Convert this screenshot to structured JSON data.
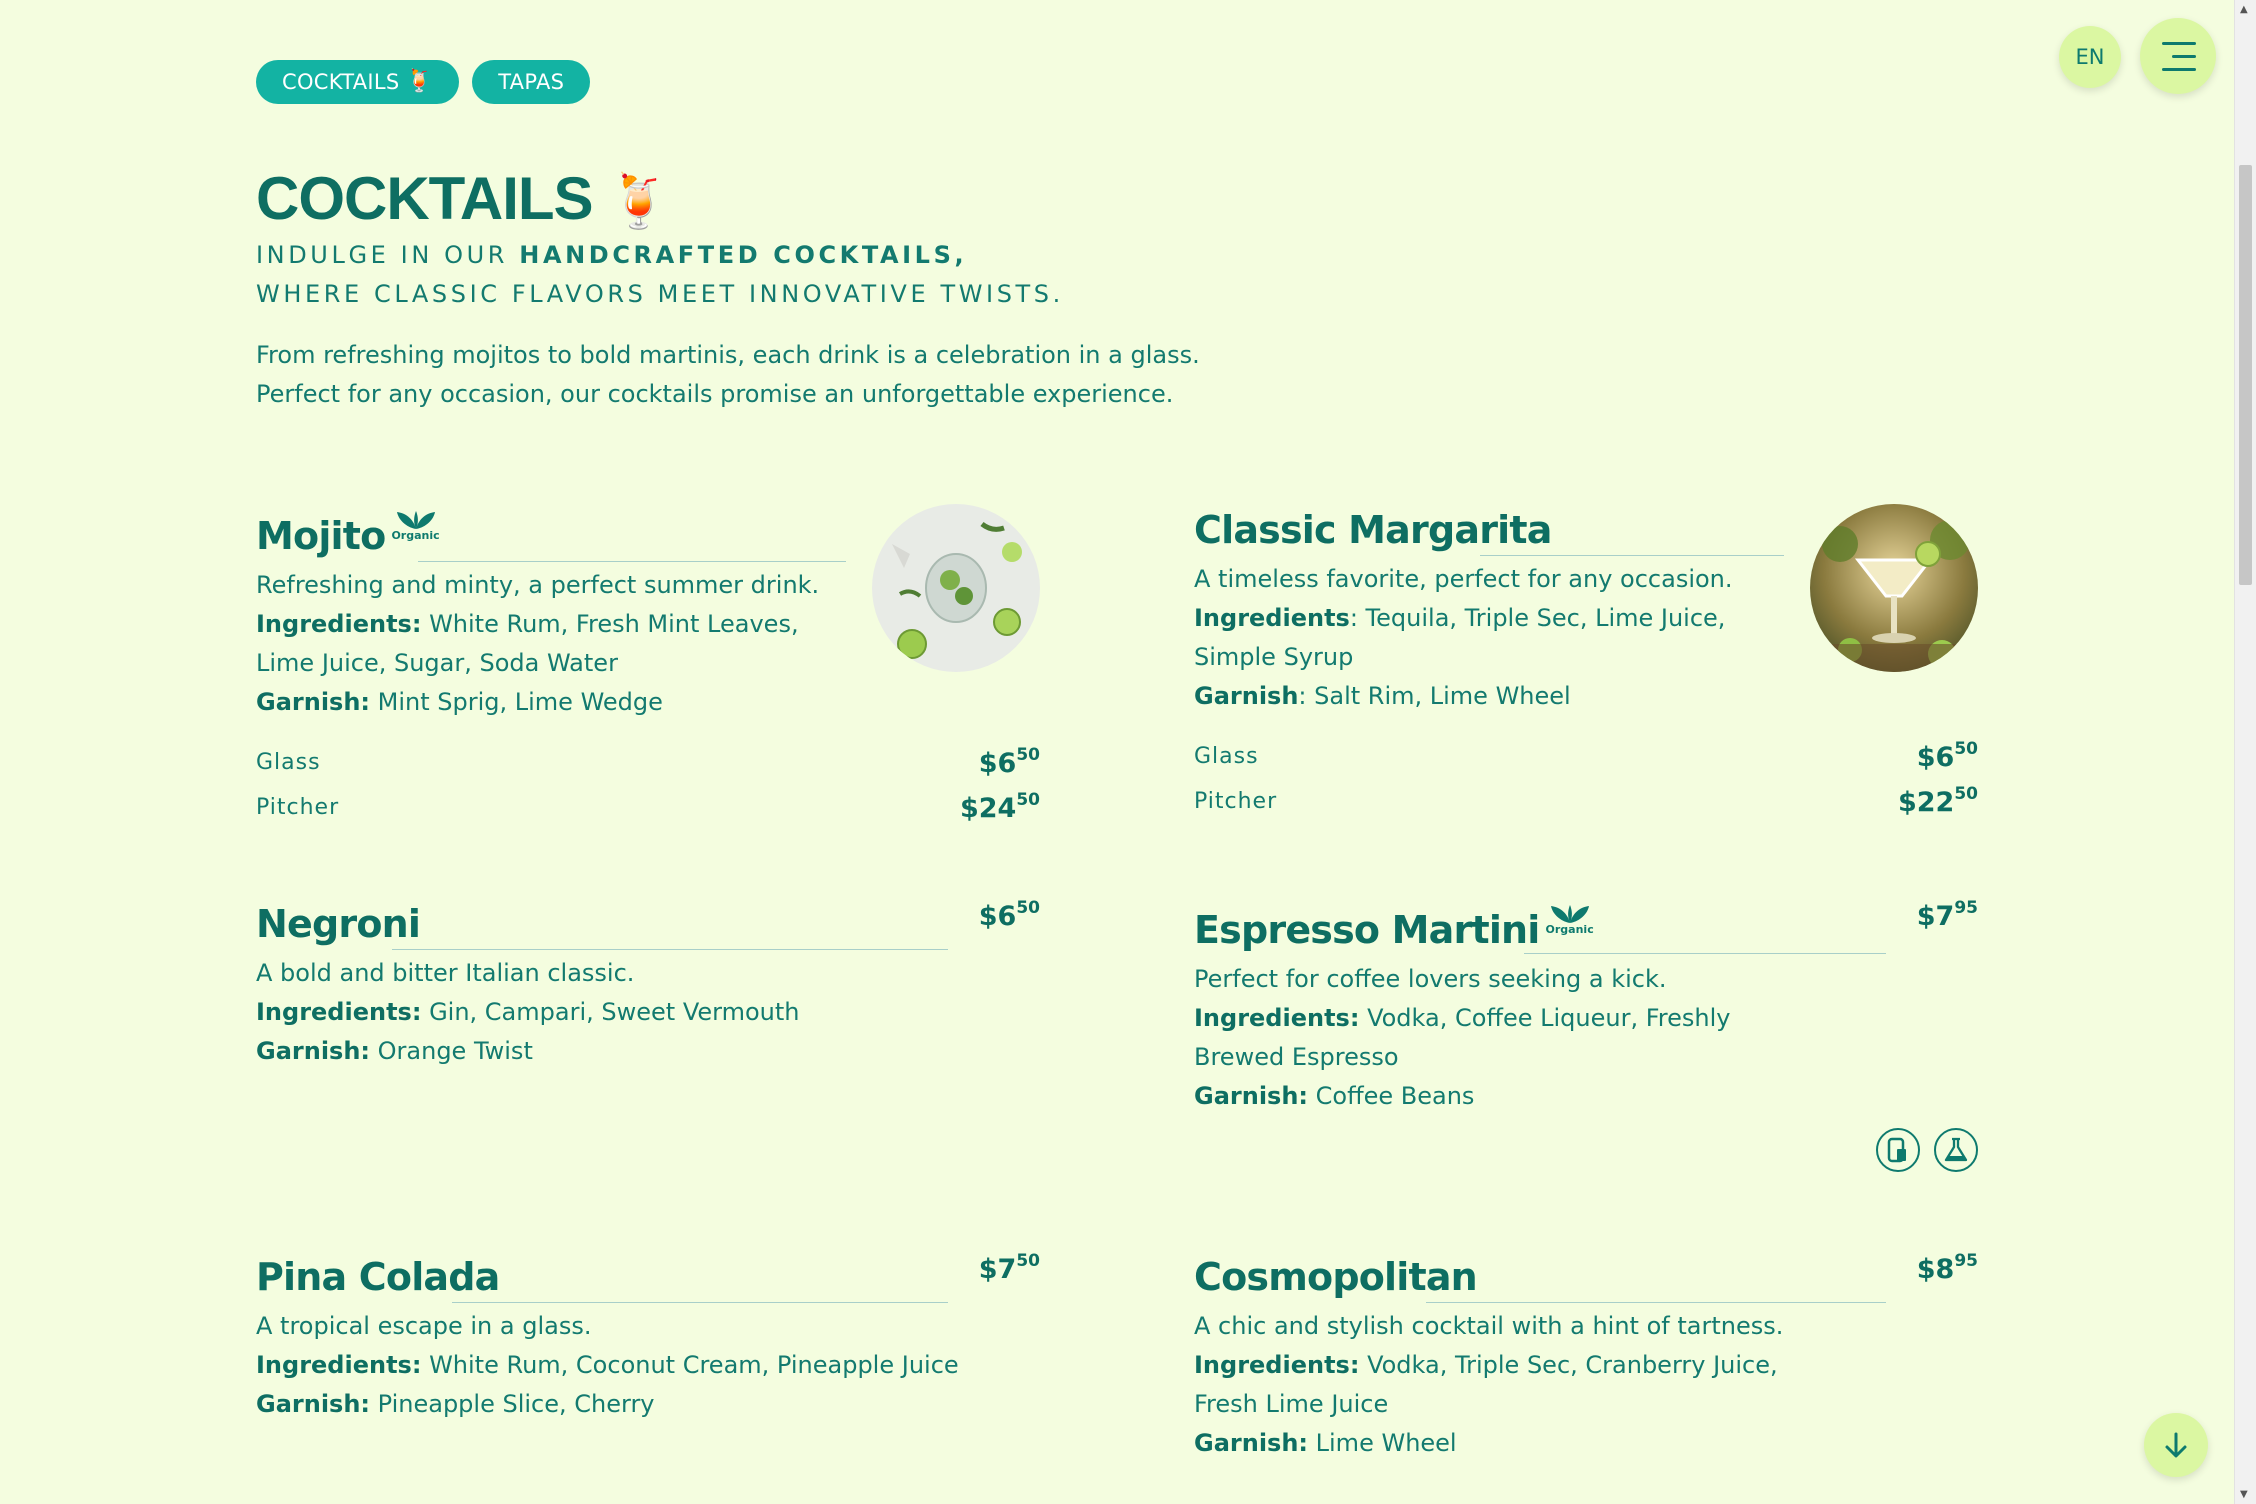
{
  "nav": {
    "tabs": [
      {
        "label": "COCKTAILS",
        "emoji": "🍹"
      },
      {
        "label": "TAPAS"
      }
    ],
    "language": "EN"
  },
  "section": {
    "title": "COCKTAILS",
    "title_emoji": "🍹",
    "subtitle_pre": "Indulge in our ",
    "subtitle_bold": "handcrafted cocktails,",
    "subtitle_line2": "where classic flavors meet innovative twists.",
    "intro_line1": "From refreshing mojitos to bold martinis, each drink is a celebration in a glass.",
    "intro_line2": "Perfect for any occasion, our cocktails promise an unforgettable experience."
  },
  "labels": {
    "ingredients": "Ingredients:",
    "ingredients_colon_sep": "Ingredients",
    "garnish": "Garnish:",
    "garnish_colon_sep": "Garnish",
    "organic": "Organic"
  },
  "items": {
    "mojito": {
      "name": "Mojito",
      "organic": true,
      "description": "Refreshing and minty, a perfect summer drink.",
      "ingredients": " White Rum, Fresh Mint Leaves, Lime Juice, Sugar, Soda Water",
      "garnish": " Mint Sprig, Lime Wedge",
      "prices": [
        {
          "label": "Glass",
          "dollars": "$6",
          "cents": "50"
        },
        {
          "label": "Pitcher",
          "dollars": "$24",
          "cents": "50"
        }
      ]
    },
    "margarita": {
      "name": "Classic Margarita",
      "description": "A timeless favorite, perfect for any occasion.",
      "ingredients": ": Tequila, Triple Sec, Lime Juice, Simple Syrup",
      "garnish": ": Salt Rim, Lime Wheel",
      "prices": [
        {
          "label": "Glass",
          "dollars": "$6",
          "cents": "50"
        },
        {
          "label": "Pitcher",
          "dollars": "$22",
          "cents": "50"
        }
      ]
    },
    "negroni": {
      "name": "Negroni",
      "dollars": "$6",
      "cents": "50",
      "description": "A bold and bitter Italian classic.",
      "ingredients": " Gin, Campari, Sweet Vermouth",
      "garnish": " Orange Twist"
    },
    "espresso_martini": {
      "name": "Espresso Martini",
      "organic": true,
      "dollars": "$7",
      "cents": "95",
      "description": "Perfect for coffee lovers seeking a kick.",
      "ingredients": " Vodka, Coffee Liqueur, Freshly Brewed Espresso",
      "garnish": " Coffee Beans",
      "icons": [
        "glass-jar-icon",
        "flask-icon"
      ]
    },
    "pina_colada": {
      "name": "Pina Colada",
      "dollars": "$7",
      "cents": "50",
      "description": "A tropical escape in a glass.",
      "ingredients": " White Rum, Coconut Cream, Pineapple Juice",
      "garnish": " Pineapple Slice, Cherry"
    },
    "cosmopolitan": {
      "name": "Cosmopolitan",
      "dollars": "$8",
      "cents": "95",
      "description": "A chic and stylish cocktail with a hint of tartness.",
      "ingredients": " Vodka, Triple Sec, Cranberry Juice, Fresh Lime Juice",
      "garnish": " Lime Wheel"
    }
  },
  "colors": {
    "background": "#f4fddf",
    "accent": "#13b3a3",
    "text": "#0e6e62",
    "button": "#dbf7a2"
  }
}
